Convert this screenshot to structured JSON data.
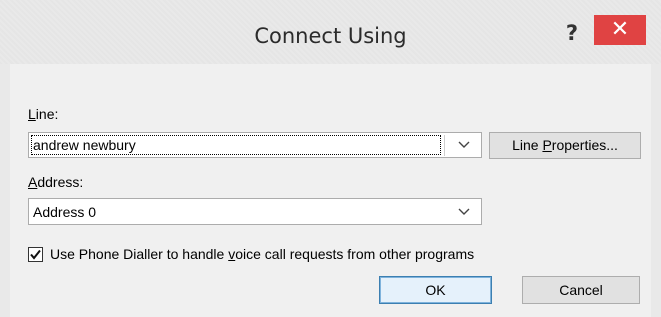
{
  "window": {
    "title": "Connect Using",
    "help_glyph": "?",
    "close_glyph": "✕"
  },
  "line": {
    "label_pre": "",
    "label_acc": "L",
    "label_post": "ine:",
    "selected_value": "andrew newbury",
    "properties_button": {
      "pre": "Line ",
      "acc": "P",
      "post": "roperties..."
    }
  },
  "address": {
    "label_pre": "",
    "label_acc": "A",
    "label_post": "ddress:",
    "selected_value": "Address 0"
  },
  "dialler_option": {
    "checked": true,
    "label_pre": "Use Phone Dialler to handle ",
    "label_acc": "v",
    "label_post": "oice call requests from other programs"
  },
  "buttons": {
    "ok": "OK",
    "cancel": "Cancel"
  },
  "colors": {
    "close_button": "#e04343",
    "default_button_border": "#3c7fb1",
    "titlebar": "#e9e9e9",
    "client": "#f0f0f0"
  },
  "icons": {
    "help": "help-icon",
    "close": "close-icon",
    "dropdown": "chevron-down-icon",
    "check": "checkmark-icon"
  }
}
